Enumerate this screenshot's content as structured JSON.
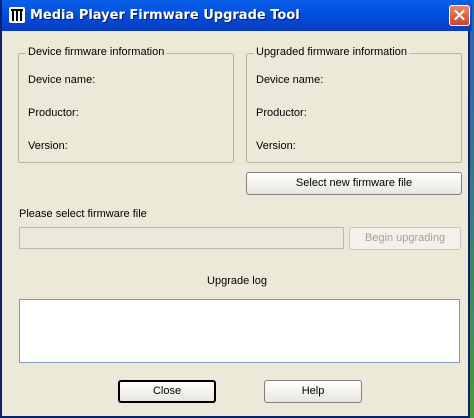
{
  "window": {
    "title": "Media Player Firmware Upgrade Tool"
  },
  "device_group": {
    "title": "Device firmware information",
    "name_label": "Device name:",
    "productor_label": "Productor:",
    "version_label": "Version:"
  },
  "upgraded_group": {
    "title": "Upgraded firmware information",
    "name_label": "Device name:",
    "productor_label": "Productor:",
    "version_label": "Version:"
  },
  "buttons": {
    "select_file": "Select new firmware file",
    "begin_upgrading": "Begin upgrading",
    "close": "Close",
    "help": "Help"
  },
  "file": {
    "label": "Please select firmware file",
    "value": ""
  },
  "log": {
    "title": "Upgrade log",
    "content": ""
  },
  "icons": {
    "app": "app-icon",
    "close": "close-icon"
  },
  "colors": {
    "titlebar": "#0050e0",
    "window_bg": "#ece9d8",
    "close_button": "#c9452a"
  }
}
